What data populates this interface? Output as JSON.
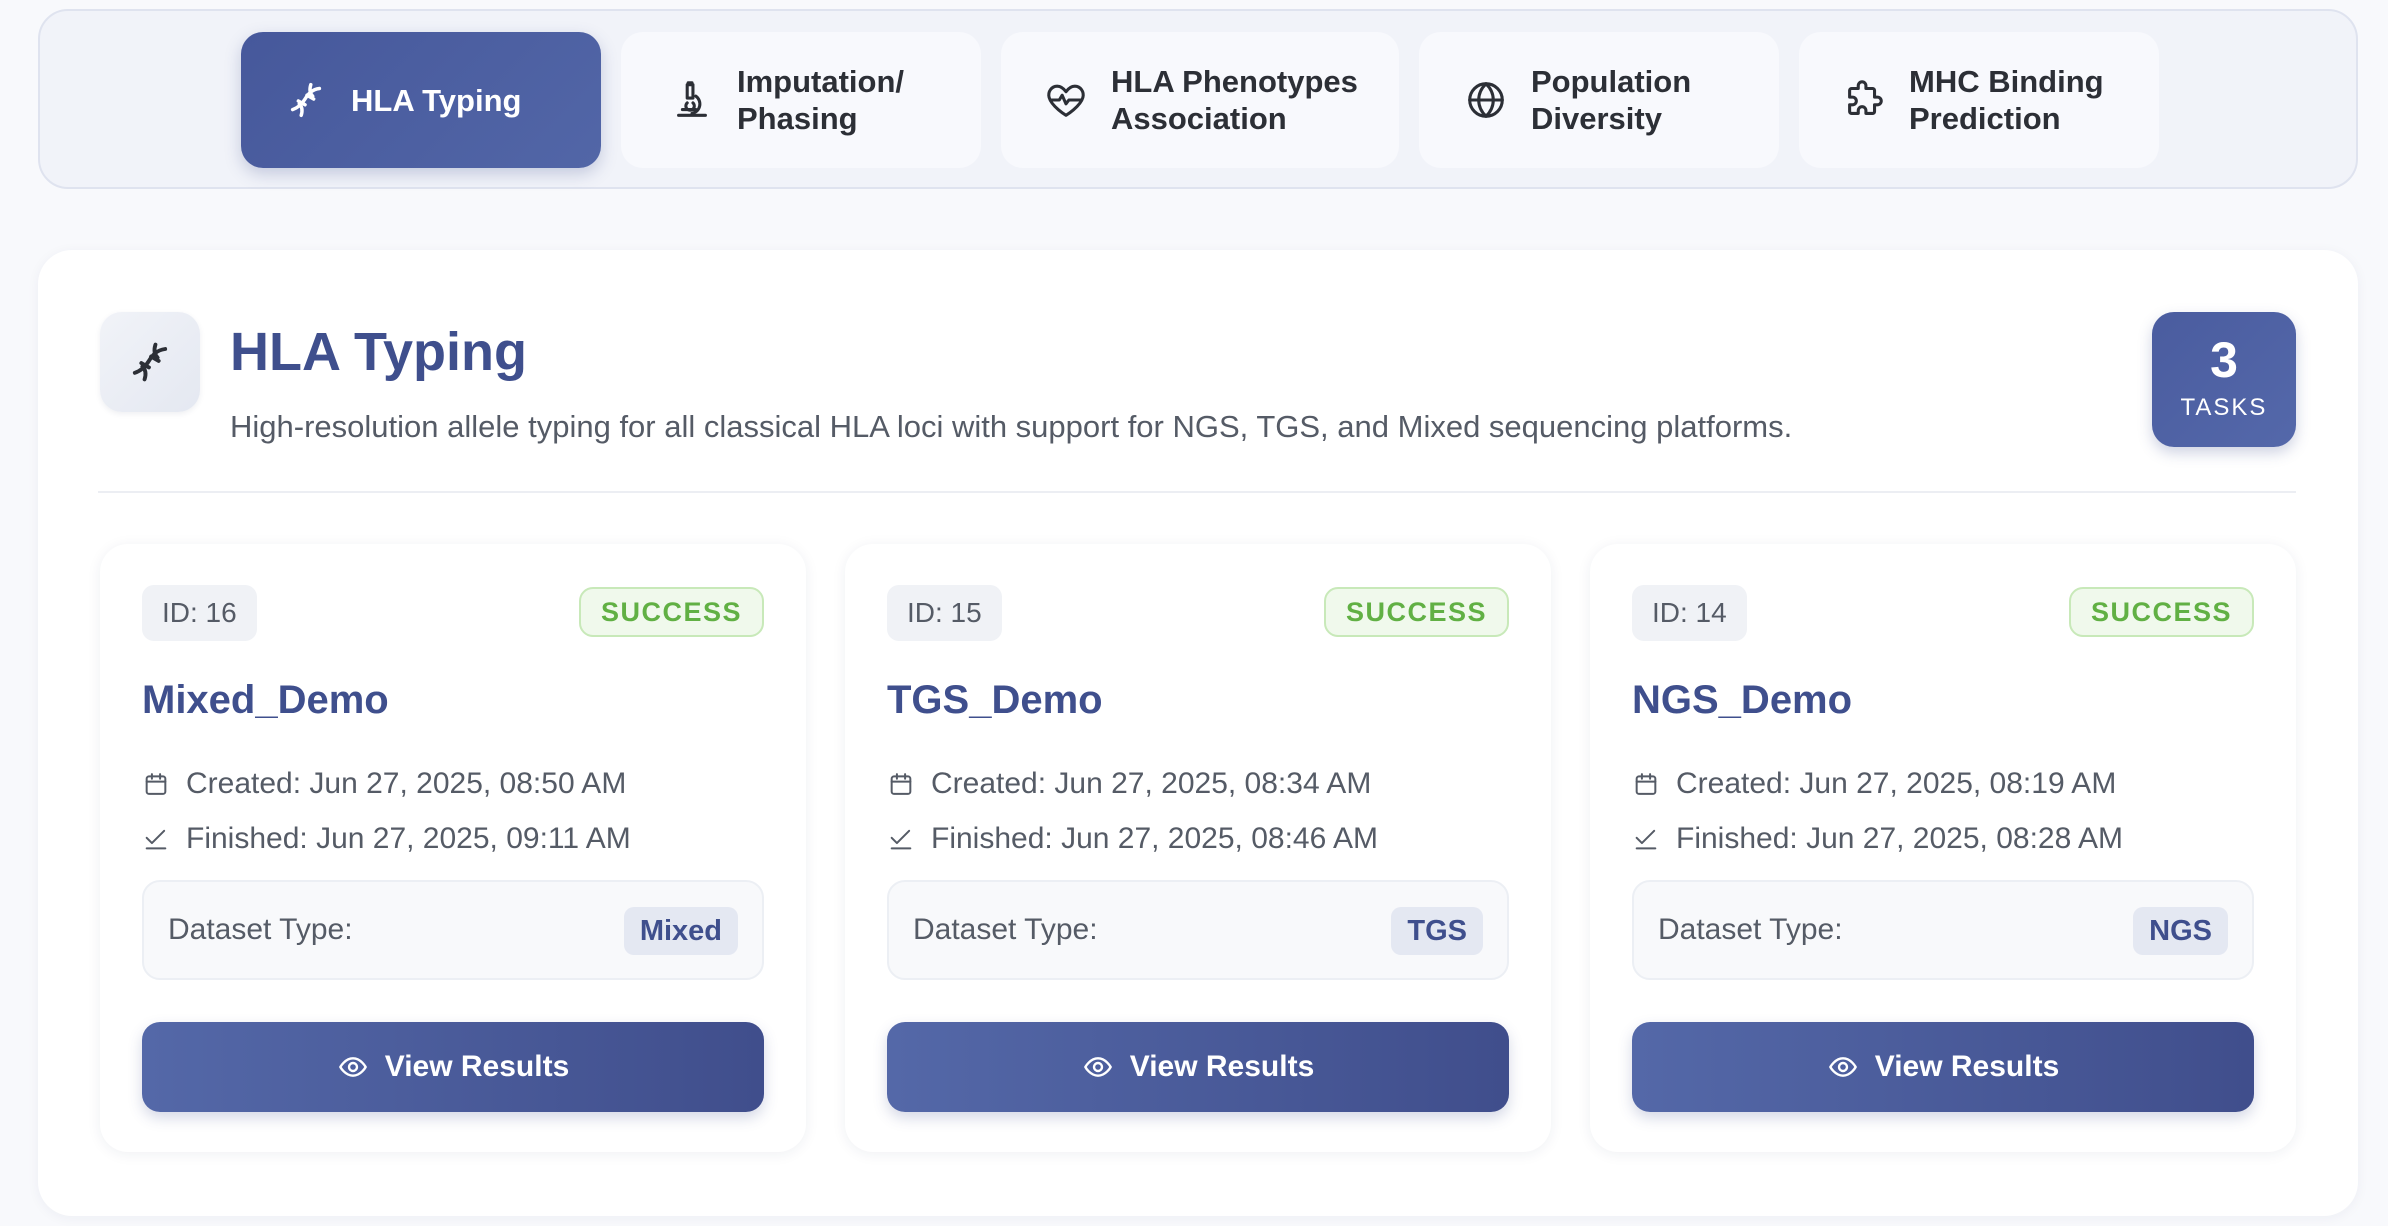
{
  "tabs": [
    {
      "label": "HLA Typing",
      "icon": "dna-icon",
      "active": true
    },
    {
      "label": "Imputation/\nPhasing",
      "icon": "microscope-icon",
      "active": false
    },
    {
      "label": "HLA Phenotypes\nAssociation",
      "icon": "heart-pulse-icon",
      "active": false
    },
    {
      "label": "Population\nDiversity",
      "icon": "globe-icon",
      "active": false
    },
    {
      "label": "MHC Binding\nPrediction",
      "icon": "puzzle-icon",
      "active": false
    }
  ],
  "section": {
    "icon": "dna-icon",
    "title": "HLA Typing",
    "description": "High-resolution allele typing for all classical HLA loci with support for NGS, TGS, and Mixed sequencing platforms.",
    "task_count": "3",
    "task_count_label": "TASKS"
  },
  "tasks": [
    {
      "id_label": "ID: 16",
      "status": "SUCCESS",
      "name": "Mixed_Demo",
      "created": "Created: Jun 27, 2025, 08:50 AM",
      "finished": "Finished: Jun 27, 2025, 09:11 AM",
      "dataset_label": "Dataset Type:",
      "dataset_type": "Mixed",
      "button_label": "View Results"
    },
    {
      "id_label": "ID: 15",
      "status": "SUCCESS",
      "name": "TGS_Demo",
      "created": "Created: Jun 27, 2025, 08:34 AM",
      "finished": "Finished: Jun 27, 2025, 08:46 AM",
      "dataset_label": "Dataset Type:",
      "dataset_type": "TGS",
      "button_label": "View Results"
    },
    {
      "id_label": "ID: 14",
      "status": "SUCCESS",
      "name": "NGS_Demo",
      "created": "Created: Jun 27, 2025, 08:19 AM",
      "finished": "Finished: Jun 27, 2025, 08:28 AM",
      "dataset_label": "Dataset Type:",
      "dataset_type": "NGS",
      "button_label": "View Results"
    }
  ],
  "colors": {
    "accent": "#46589b",
    "title": "#3f4f8d",
    "success": "#61b044",
    "success_bg": "#f0f9ec"
  }
}
